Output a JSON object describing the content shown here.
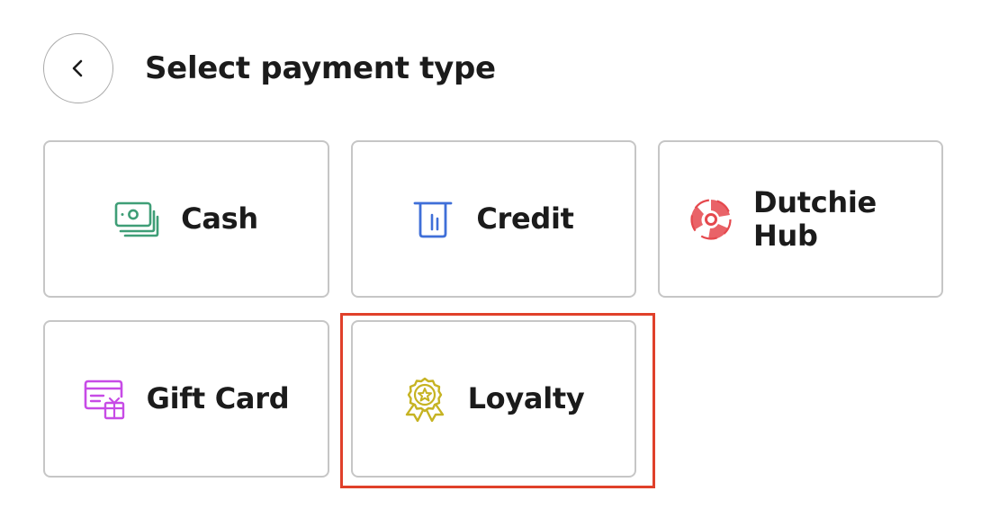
{
  "header": {
    "back_icon": "chevron-left-icon",
    "title": "Select payment type"
  },
  "payment_types": [
    {
      "label": "Cash",
      "icon": "cash-icon",
      "color": "#3f9e77"
    },
    {
      "label": "Credit",
      "icon": "card-reader-icon",
      "color": "#3f6fd8"
    },
    {
      "label": "Dutchie Hub",
      "icon": "dutchie-hub-icon",
      "color": "#e5484d"
    },
    {
      "label": "Gift Card",
      "icon": "gift-card-icon",
      "color": "#c74be6"
    },
    {
      "label": "Loyalty",
      "icon": "loyalty-badge-icon",
      "color": "#c6b322"
    }
  ],
  "highlight": {
    "target": "Loyalty",
    "color": "#e0402a"
  }
}
